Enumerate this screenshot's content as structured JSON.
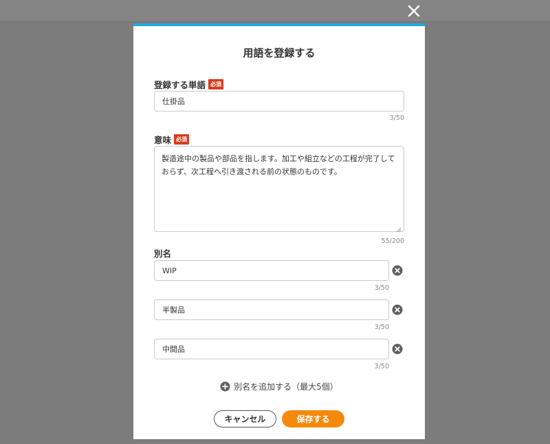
{
  "modal": {
    "title": "用語を登録する",
    "required_badge": "必須"
  },
  "word": {
    "label": "登録する単語",
    "value": "仕掛品",
    "count": "3/50"
  },
  "meaning": {
    "label": "意味",
    "value": "製造途中の製品や部品を指します。加工や組立などの工程が完了しておらず、次工程へ引き渡される前の状態のものです。",
    "count": "55/200"
  },
  "aliases": {
    "label": "別名",
    "items": [
      {
        "value": "WIP",
        "count": "3/50"
      },
      {
        "value": "半製品",
        "count": "3/50"
      },
      {
        "value": "中間品",
        "count": "3/50"
      }
    ],
    "add_label": "別名を追加する（最大5個）"
  },
  "buttons": {
    "cancel": "キャンセル",
    "save": "保存する"
  },
  "colors": {
    "accent_top": "#1ea7e1",
    "required": "#d63c1c",
    "save": "#f5890c"
  },
  "icons": {
    "close": "close-icon",
    "remove": "remove-circle-icon",
    "add": "plus-circle-icon"
  }
}
